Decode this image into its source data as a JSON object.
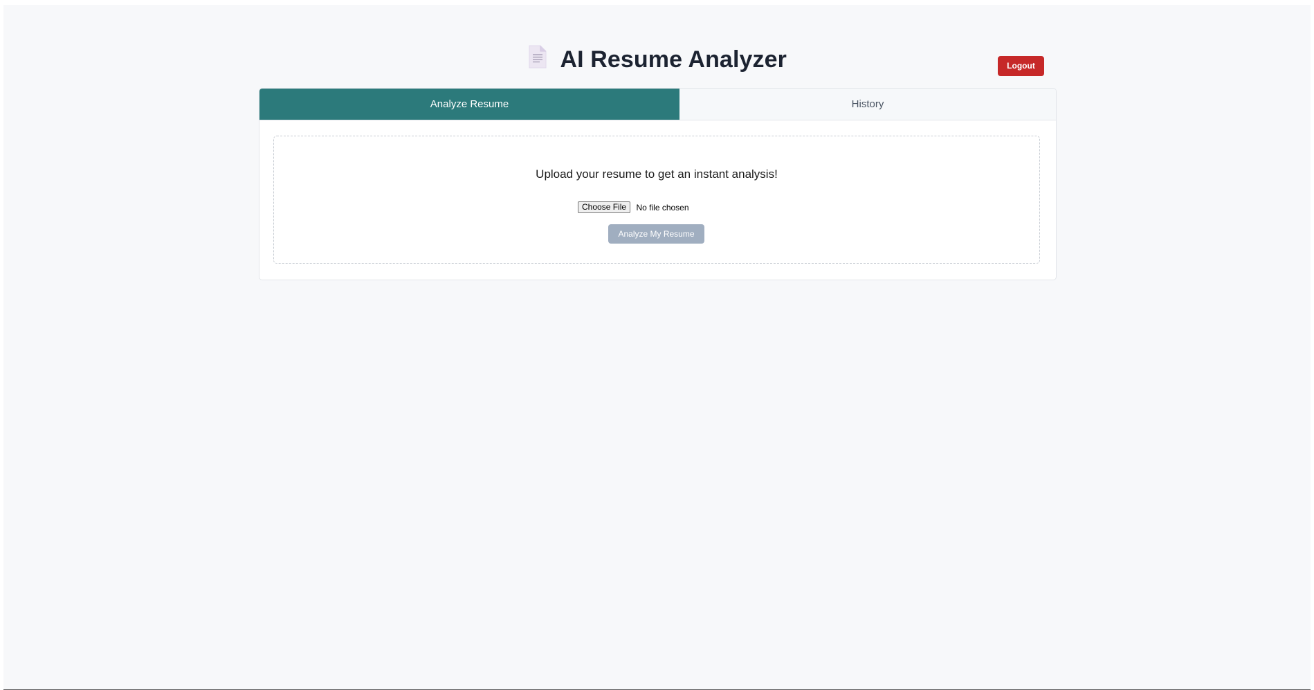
{
  "header": {
    "icon": "document-icon",
    "title": "AI Resume Analyzer",
    "logout_label": "Logout"
  },
  "tabs": [
    {
      "label": "Analyze Resume",
      "active": true
    },
    {
      "label": "History",
      "active": false
    }
  ],
  "upload": {
    "prompt": "Upload your resume to get an instant analysis!",
    "choose_file_label": "Choose File",
    "file_status": "No file chosen",
    "analyze_label": "Analyze My Resume",
    "analyze_disabled": true
  },
  "colors": {
    "primary": "#2c7a7b",
    "danger": "#c62828",
    "disabled": "#a0aec0",
    "background": "#f7f8fa"
  }
}
